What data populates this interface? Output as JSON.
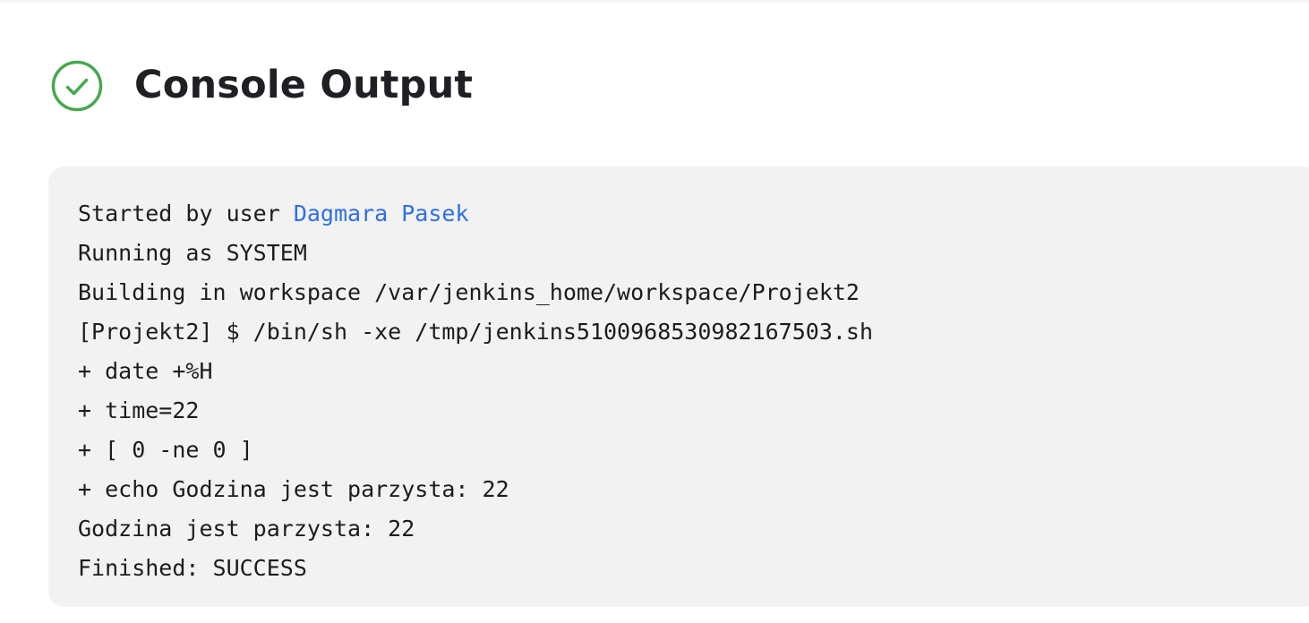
{
  "header": {
    "status_icon": "check-circle-icon",
    "status_color": "#48a84f",
    "title": "Console Output"
  },
  "console": {
    "started_prefix": "Started by user ",
    "started_user": "Dagmara Pasek",
    "link_color": "#2f6ee8",
    "lines": [
      "Running as SYSTEM",
      "Building in workspace /var/jenkins_home/workspace/Projekt2",
      "[Projekt2] $ /bin/sh -xe /tmp/jenkins5100968530982167503.sh",
      "+ date +%H",
      "+ time=22",
      "+ [ 0 -ne 0 ]",
      "+ echo Godzina jest parzysta: 22",
      "Godzina jest parzysta: 22",
      "Finished: SUCCESS"
    ]
  }
}
